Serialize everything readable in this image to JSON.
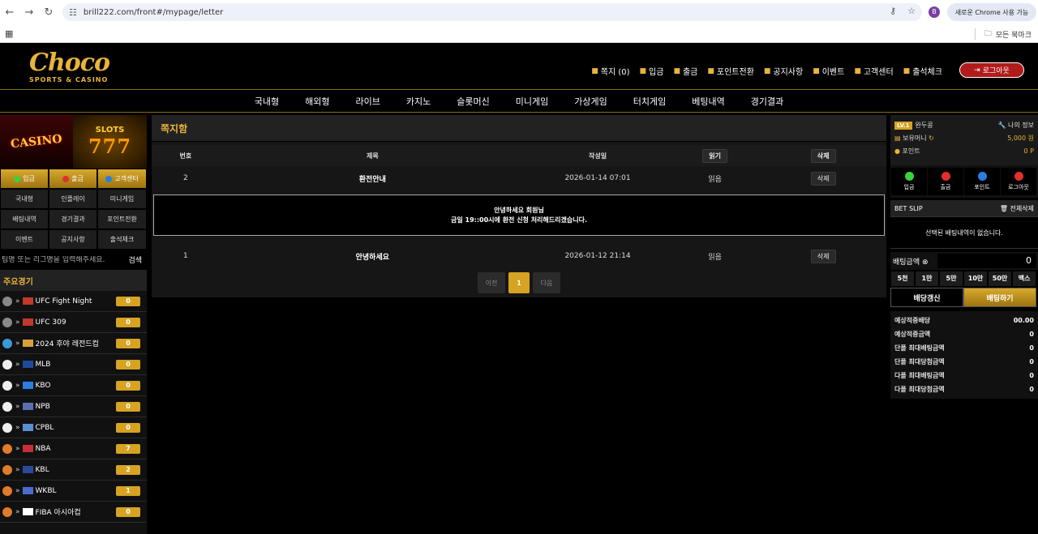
{
  "browser": {
    "url": "brill222.com/front#/mypage/letter",
    "chrome_update": "새로운 Chrome 사용 가능",
    "profile_initial": "B",
    "all_bookmarks": "모든 북마크"
  },
  "header": {
    "brand": "Choco",
    "brand_sub": "SPORTS & CASINO",
    "links": [
      {
        "label": "쪽지 (0)",
        "icon": "envelope-icon"
      },
      {
        "label": "입금",
        "icon": "wallet-icon"
      },
      {
        "label": "출금",
        "icon": "cash-icon"
      },
      {
        "label": "포인트전환",
        "icon": "coin-icon"
      },
      {
        "label": "공지사항",
        "icon": "bell-icon"
      },
      {
        "label": "이벤트",
        "icon": "gift-icon"
      },
      {
        "label": "고객센터",
        "icon": "headset-icon"
      },
      {
        "label": "출석체크",
        "icon": "calendar-icon"
      }
    ],
    "logout": "로그아웃"
  },
  "main_nav": [
    "국내형",
    "해외형",
    "라이브",
    "카지노",
    "슬롯머신",
    "미니게임",
    "가상게임",
    "터치게임",
    "베팅내역",
    "경기결과"
  ],
  "left": {
    "banner_casino": "CASINO",
    "banner_slots": "SLOTS",
    "banner_slots_num": "777",
    "quick": [
      {
        "label": "입금",
        "style": "gold",
        "dot": "#3bd13b"
      },
      {
        "label": "출금",
        "style": "gold",
        "dot": "#e0302c"
      },
      {
        "label": "고객센터",
        "style": "gold",
        "dot": "#2a7de1"
      },
      {
        "label": "국내형",
        "style": "dark"
      },
      {
        "label": "인플레이",
        "style": "dark"
      },
      {
        "label": "미니게임",
        "style": "dark"
      },
      {
        "label": "배팅내역",
        "style": "dark"
      },
      {
        "label": "경기결과",
        "style": "dark"
      },
      {
        "label": "포인트전환",
        "style": "dark"
      },
      {
        "label": "이벤트",
        "style": "dark"
      },
      {
        "label": "공지사항",
        "style": "dark"
      },
      {
        "label": "출석체크",
        "style": "dark"
      }
    ],
    "search_placeholder": "팀명 또는 리그명을 입력해주세요.",
    "search_btn": "검색",
    "major_title": "주요경기",
    "leagues": [
      {
        "name": "UFC Fight Night",
        "count": "0",
        "sport": "#888",
        "flag": "#c0392b"
      },
      {
        "name": "UFC 309",
        "count": "0",
        "sport": "#888",
        "flag": "#c0392b"
      },
      {
        "name": "2024 후야 레전드컵",
        "count": "0",
        "sport": "#3a9ad9",
        "flag": "#d4a23a"
      },
      {
        "name": "MLB",
        "count": "0",
        "sport": "#eee",
        "flag": "#1e4a9c"
      },
      {
        "name": "KBO",
        "count": "0",
        "sport": "#eee",
        "flag": "#2a7de1"
      },
      {
        "name": "NPB",
        "count": "0",
        "sport": "#eee",
        "flag": "#5a6fb0"
      },
      {
        "name": "CPBL",
        "count": "0",
        "sport": "#eee",
        "flag": "#5a8fd0"
      },
      {
        "name": "NBA",
        "count": "7",
        "sport": "#e07b2a",
        "flag": "#c82d3d"
      },
      {
        "name": "KBL",
        "count": "2",
        "sport": "#e07b2a",
        "flag": "#2a4a9c"
      },
      {
        "name": "WKBL",
        "count": "1",
        "sport": "#e07b2a",
        "flag": "#4a6ad0"
      },
      {
        "name": "FIBA 아시아컵",
        "count": "0",
        "sport": "#e07b2a",
        "flag": "#ffffff"
      }
    ]
  },
  "letters": {
    "title": "쪽지함",
    "columns": {
      "no": "번호",
      "title": "제목",
      "date": "작성일",
      "read_all": "읽기",
      "delete_all": "삭제"
    },
    "rows": [
      {
        "no": "2",
        "title": "환전안내",
        "date": "2026-01-14 07:01",
        "status": "읽음",
        "delete": "삭제",
        "body1": "안녕하세요 회원님",
        "body2": "금일 19::00시에 환전 신청 처리해드리겠습니다."
      },
      {
        "no": "1",
        "title": "안녕하세요",
        "date": "2026-01-12 21:14",
        "status": "읽음",
        "delete": "삭제"
      }
    ],
    "pager": {
      "prev": "이전",
      "page": "1",
      "next": "다음"
    }
  },
  "right": {
    "level": "LV.1",
    "username": "완두콩",
    "myinfo": "나의 정보",
    "money_label": "보유머니",
    "money_value": "5,000 원",
    "point_label": "포인트",
    "point_value": "0 P",
    "actions": [
      {
        "label": "입금",
        "color": "#3bd13b"
      },
      {
        "label": "출금",
        "color": "#e0302c"
      },
      {
        "label": "포인트",
        "color": "#2a7de1"
      },
      {
        "label": "로그아웃",
        "color": "#e0302c"
      }
    ],
    "betslip_title": "BET SLIP",
    "betslip_clear": "전체삭제",
    "betslip_empty": "선택된 배팅내역이 없습니다.",
    "bet_amount_label": "배팅금액",
    "bet_amount_value": "0",
    "chips": [
      "5천",
      "1만",
      "5만",
      "10만",
      "50만",
      "맥스"
    ],
    "refresh_btn": "배당갱신",
    "bet_btn": "배팅하기",
    "summary": [
      {
        "label": "예상적중배당",
        "value": "00.00"
      },
      {
        "label": "예상적중금액",
        "value": "0"
      },
      {
        "label": "단폴 최대배팅금액",
        "value": "0"
      },
      {
        "label": "단폴 최대당첨금액",
        "value": "0"
      },
      {
        "label": "다폴 최대배팅금액",
        "value": "0"
      },
      {
        "label": "다폴 최대당첨금액",
        "value": "0"
      }
    ]
  }
}
